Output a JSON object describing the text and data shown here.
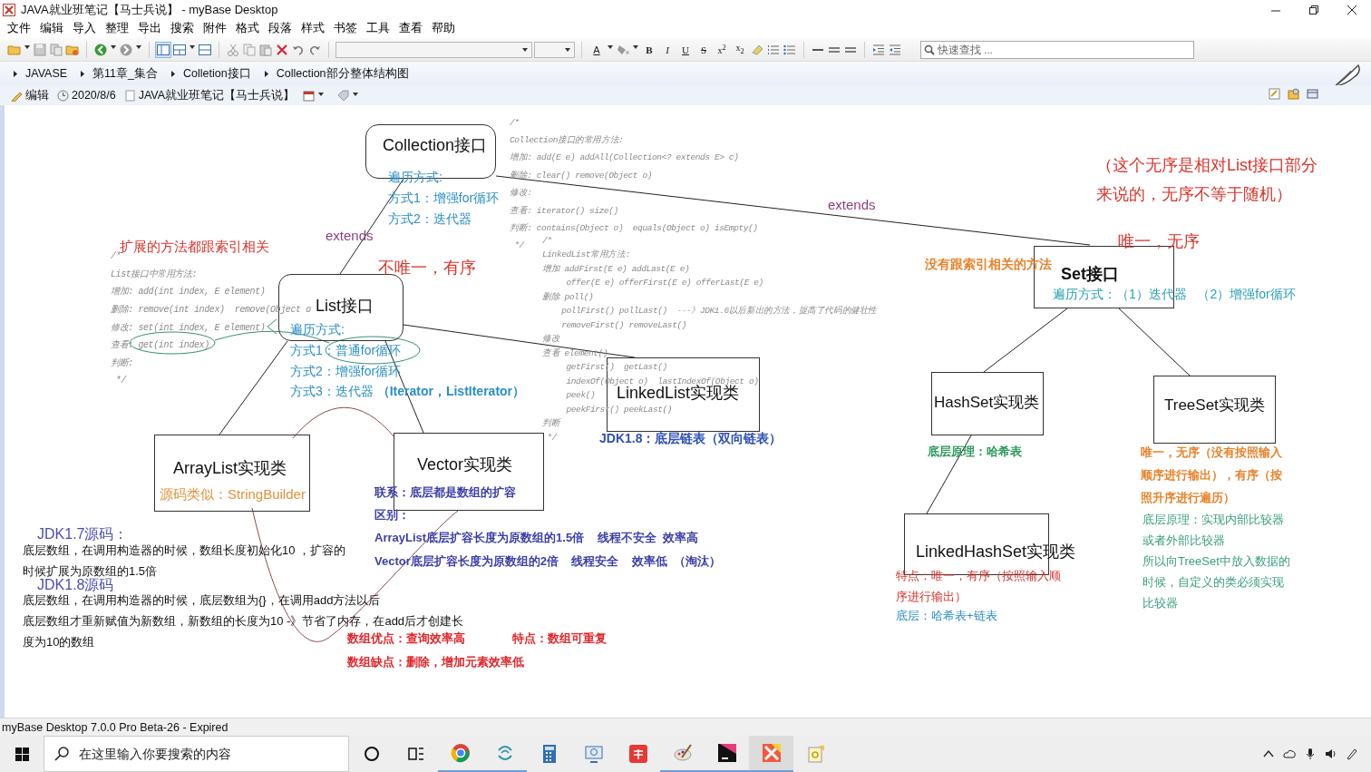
{
  "window": {
    "title": "JAVA就业班笔记【马士兵说】 - myBase Desktop"
  },
  "menu": [
    "文件",
    "编辑",
    "导入",
    "整理",
    "导出",
    "搜索",
    "附件",
    "格式",
    "段落",
    "样式",
    "书签",
    "工具",
    "查看",
    "帮助"
  ],
  "toolbar": {
    "format_buttons": [
      {
        "label": "A",
        "kind": "color"
      },
      {
        "label": "B",
        "kind": "bold"
      },
      {
        "label": "I",
        "kind": "italic"
      },
      {
        "label": "U",
        "kind": "underline"
      },
      {
        "label": "S",
        "kind": "strike"
      },
      {
        "label": "x$^{2}$",
        "kind": "script"
      },
      {
        "label": "x$_{2}$",
        "kind": "script"
      }
    ],
    "search": {
      "placeholder": "快速查找 ..."
    }
  },
  "breadcrumb": [
    "JAVASE",
    "第11章_集合",
    "Colletion接口",
    "Collection部分整体结构图"
  ],
  "info_bar": {
    "mode": "编辑",
    "date": "2020/8/6",
    "notebook": "JAVA就业班笔记【马士兵说】"
  },
  "diagram": {
    "boxes": [
      {
        "label": "Collection接口",
        "kind": "rounded",
        "bold": false
      },
      {
        "label": "List接口",
        "kind": "rounded",
        "bold": false
      },
      {
        "label": "LinkedList实现类",
        "kind": "rect",
        "bold": false
      },
      {
        "label": "ArrayList实现类",
        "kind": "rect",
        "bold": false
      },
      {
        "label": "Vector实现类",
        "kind": "rect",
        "bold": false
      },
      {
        "label": "Set接口",
        "kind": "rect",
        "bold": true
      },
      {
        "label": "HashSet实现类",
        "kind": "rect",
        "bold": false
      },
      {
        "label": "TreeSet实现类",
        "kind": "rect",
        "bold": false
      },
      {
        "label": "LinkedHashSet实现类",
        "kind": "rect",
        "bold": false
      }
    ],
    "notes": [
      {
        "kind": "plain",
        "color": "#2a8fc4",
        "lines": [
          "遍历方式:",
          "方式1：增强for循环",
          "方式2：迭代器"
        ]
      },
      {
        "kind": "plain",
        "color": "#8e3f7e",
        "lines": [
          "extends"
        ]
      },
      {
        "kind": "plain",
        "color": "#d9342b",
        "lines": [
          "扩展的方法都跟索引相关"
        ]
      },
      {
        "kind": "code",
        "lines": [
          "/*",
          "Collection接口的常用方法:",
          "增加: add(E e) addAll(Collection<? extends E> c)",
          "删除: clear() remove(Object o)",
          "修改:",
          "查看: iterator() size()",
          "判断: contains(Object o)  equals(Object o) isEmpty()",
          " */"
        ]
      },
      {
        "kind": "plain",
        "color": "#8e3f7e",
        "lines": [
          "extends"
        ]
      },
      {
        "kind": "plain",
        "color": "#d9342b",
        "lines": [
          "（这个无序是相对List接口部分",
          "来说的，无序不等于随机）"
        ]
      },
      {
        "kind": "plain",
        "color": "#d9342b",
        "lines": [
          "唯一，无序"
        ]
      },
      {
        "kind": "code",
        "lines": [
          "/*",
          "List接口中常用方法:",
          "增加: add(int index, E element)",
          "删除: remove(int index)  remove(Object o",
          "修改: set(int index, E element)",
          "查看: get(int index)",
          "判断:",
          " */"
        ]
      },
      {
        "kind": "plain",
        "color": "#d9342b",
        "lines": [
          "不唯一，有序"
        ]
      },
      {
        "kind": "plain",
        "color": "#2a8fc4",
        "lines": [
          "遍历方式:",
          "方式1：普通for循环",
          "方式2：增强for循环",
          "方式3：迭代器 **（Iterator，ListIterator）**"
        ]
      },
      {
        "kind": "code",
        "lines": [
          "/*",
          "LinkedList常用方法:",
          "增加 addFirst(E e) addLast(E e)",
          "     offer(E e) offerFirst(E e) offerLast(E e)",
          "删除 poll()",
          "    pollFirst() pollLast()  ---》JDK1.6以后新出的方法，提高了代码的健壮性",
          "    removeFirst() removeLast()",
          "修改",
          "查看 element()",
          "     getFirst()  getLast()",
          "     indexOf(Object o)  lastIndexOf(Object o)",
          "     peek()",
          "     peekFirst() peekLast()",
          "判断",
          " */"
        ]
      },
      {
        "kind": "bold",
        "color": "#e8822a",
        "lines": [
          "没有跟索引相关的方法"
        ]
      },
      {
        "kind": "plain",
        "color": "#2a9fb0",
        "lines": [
          "遍历方式：（1）迭代器   （2）增强for循环"
        ]
      },
      {
        "kind": "bold",
        "color": "#2e4fb8",
        "lines": [
          "JDK1.8：底层链表（双向链表）"
        ]
      },
      {
        "kind": "bold",
        "color": "#2a9a5a",
        "lines": [
          "底层原理：哈希表"
        ]
      },
      {
        "kind": "plain",
        "color": "#e0913a",
        "lines": [
          "源码类似：StringBuilder"
        ]
      },
      {
        "kind": "bold",
        "color": "#e8822a",
        "lines": [
          "唯一，无序（没有按照输入",
          "顺序进行输出），有序（按",
          "照升序进行遍历）"
        ]
      },
      {
        "kind": "plain",
        "color": "#4a4fb0",
        "lines": [
          "JDK1.7源码："
        ]
      },
      {
        "kind": "plain",
        "color": "#111111",
        "lines": [
          "底层数组，在调用构造器的时候，数组长度初始化10 ，扩容的",
          "时候扩展为原数组的1.5倍"
        ]
      },
      {
        "kind": "bold",
        "color": "#3b3fa8",
        "lines": [
          "联系：底层都是数组的扩容",
          "区别：",
          "ArrayList底层扩容长度为原数组的1.5倍    线程不安全  效率高",
          "Vector底层扩容长度为原数组的2倍    线程安全    效率低  （淘汰）"
        ]
      },
      {
        "kind": "plain",
        "color": "#4a4fb0",
        "lines": [
          "JDK1.8源码"
        ]
      },
      {
        "kind": "plain",
        "color": "#111111",
        "lines": [
          "底层数组，在调用构造器的时候，底层数组为{}，在调用add方法以后",
          "底层数组才重新赋值为新数组，新数组的长度为10 -》节省了内存，在add后才创建长",
          "度为10的数组"
        ]
      },
      {
        "kind": "plain",
        "color": "#d9342b",
        "lines": [
          "特点：唯一，有序（按照输入顺",
          "序进行输出）"
        ]
      },
      {
        "kind": "plain",
        "color": "#2a8fc4",
        "lines": [
          "底层：哈希表+链表"
        ]
      },
      {
        "kind": "plain",
        "color": "#3aa07a",
        "lines": [
          "底层原理：实现内部比较器",
          "或者外部比较器",
          "所以向TreeSet中放入数据的",
          "时候，自定义的类必须实现",
          "比较器"
        ]
      },
      {
        "kind": "bold",
        "color": "#e0262a",
        "lines": [
          "数组优点：查询效率高",
          "数组缺点：删除，增加元素效率低"
        ]
      },
      {
        "kind": "bold",
        "color": "#e0262a",
        "lines": [
          "特点：数组可重复"
        ]
      }
    ]
  },
  "status_bar": "myBase Desktop 7.0.0 Pro Beta-26 - Expired",
  "taskbar": {
    "search": {
      "placeholder": "在这里输入你要搜索的内容"
    }
  }
}
